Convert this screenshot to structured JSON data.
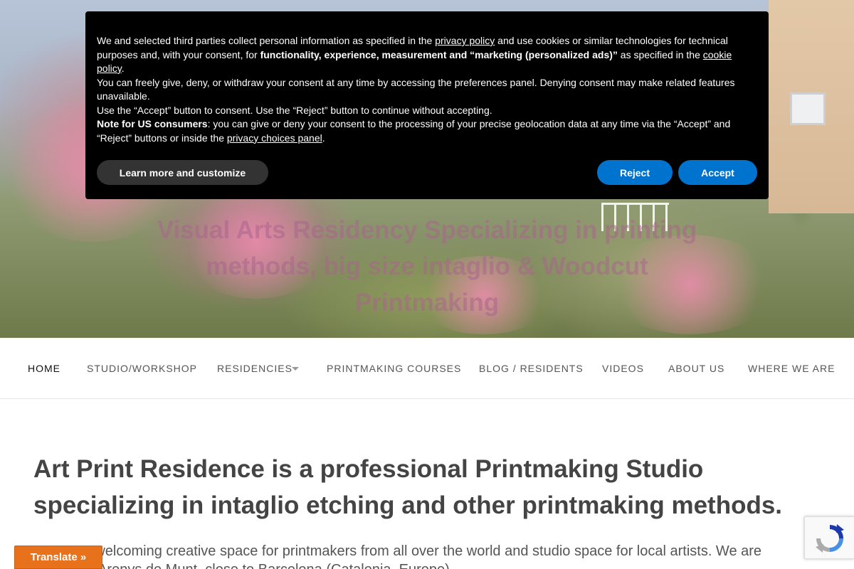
{
  "hero": {
    "tagline": "Visual Arts Residency Specializing in printing methods, big size intaglio & Woodcut Printmaking"
  },
  "cookie_banner": {
    "p1_a": "We and selected third parties collect personal information as specified in the ",
    "p1_link1": "privacy policy",
    "p1_b": " and use cookies or similar technologies for technical purposes and, with your consent, for ",
    "p1_bold": "functionality, experience, measurement and “marketing (personalized ads)”",
    "p1_c": " as specified in the ",
    "p1_link2": "cookie policy",
    "p1_d": ".",
    "p2": "You can freely give, deny, or withdraw your consent at any time by accessing the preferences panel. Denying consent may make related features unavailable.",
    "p3": "Use the “Accept” button to consent. Use the “Reject” button to continue without accepting.",
    "p4_bold": "Note for US consumers",
    "p4_a": ": you can give or deny your consent to the processing of your precise geolocation data at any time via the “Accept” and “Reject” buttons or inside the ",
    "p4_link": "privacy choices panel",
    "p4_b": ".",
    "learn_more_label": "Learn more and customize",
    "reject_label": "Reject",
    "accept_label": "Accept"
  },
  "nav": {
    "items": [
      {
        "label": "HOME"
      },
      {
        "label": "STUDIO/WORKSHOP"
      },
      {
        "label": "RESIDENCIES"
      },
      {
        "label": "PRINTMAKING COURSES"
      },
      {
        "label": "BLOG / RESIDENTS"
      },
      {
        "label": "VIDEOS"
      },
      {
        "label": "ABOUT US"
      },
      {
        "label": "WHERE WE ARE"
      }
    ]
  },
  "main": {
    "heading": "Art Print Residence is a professional Printmaking Studio specializing in intaglio etching and other printmaking methods.",
    "paragraph": "We are a welcoming creative space for printmakers from all over the world and studio space for local artists. We are located in Arenys de Munt, close to Barcelona (Catalonia, Europe)."
  },
  "translate": {
    "label": "Translate »"
  },
  "icons": {
    "recaptcha": "recaptcha-icon",
    "caret": "chevron-down-icon"
  },
  "colors": {
    "accent": "#0073ce",
    "translate": "#e8721c",
    "banner_bg": "#000000"
  }
}
